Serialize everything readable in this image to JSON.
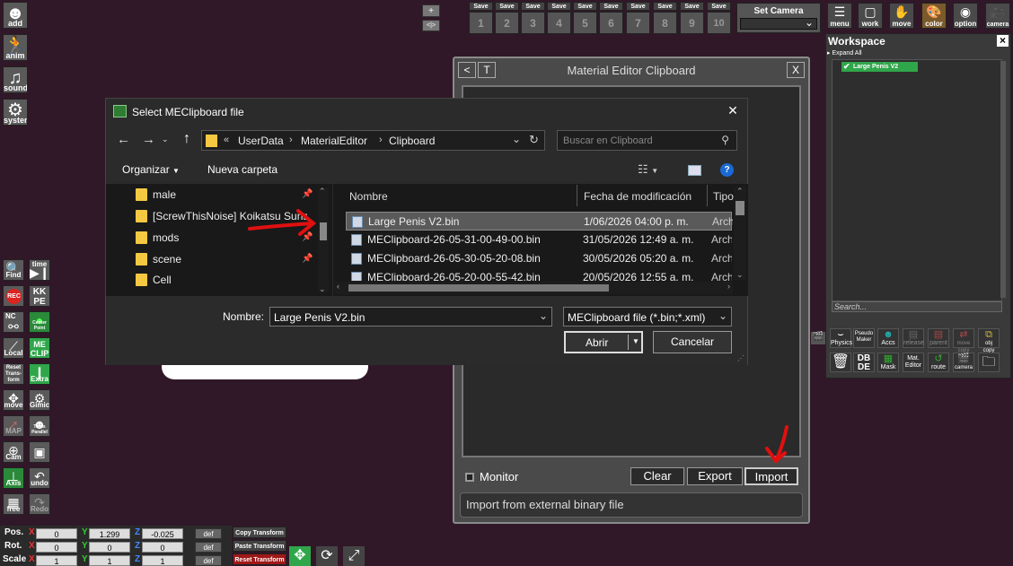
{
  "left_menu": {
    "add": "add",
    "anim": "anim",
    "sound": "sound",
    "system": "system"
  },
  "left_tools": {
    "find": "Find",
    "time": "time",
    "rec": "REC",
    "kkpe": "KK PE",
    "nc": "NC",
    "center_point": "Center Point",
    "local": "Local",
    "me_clip": "ME CLIP",
    "reset_transform": "Reset Trans-form",
    "extra": "Extra",
    "move": "move",
    "gimick": "Gimick",
    "map": "MAP",
    "trans_parallel": "Trans Parallel",
    "cam": "Cam",
    "save": "",
    "axis": "Axis",
    "undo": "undo",
    "free": "free",
    "redo": "Redo"
  },
  "top_center": {
    "plus": "+",
    "arrows": "<|>"
  },
  "save_slots": {
    "label": "Save",
    "numbers": [
      "1",
      "2",
      "3",
      "4",
      "5",
      "6",
      "7",
      "8",
      "9",
      "10"
    ]
  },
  "set_camera": {
    "label": "Set Camera"
  },
  "top_tools": [
    "menu",
    "work",
    "move",
    "color",
    "option",
    "camera"
  ],
  "workspace": {
    "title": "Workspace",
    "close": "×",
    "expand_all": "Expand All",
    "item": "Large Penis V2",
    "search_placeholder": "Search...",
    "buttons_row1": [
      "Physics",
      "Pseudo Maker",
      "Accs",
      "release",
      "parent",
      "move copy",
      "obj copy"
    ],
    "buttons_row2": [
      "",
      "DB DE",
      "Mask",
      "Mat. Editor",
      "route",
      "camera",
      ""
    ]
  },
  "material_editor": {
    "title": "Material Editor Clipboard",
    "back": "<",
    "t": "T",
    "close": "X",
    "monitor": "Monitor",
    "clear": "Clear",
    "export": "Export",
    "import": "Import",
    "status": "Import from external binary file"
  },
  "dialog": {
    "title": "Select MEClipboard file",
    "close": "✕",
    "path": [
      "«",
      "UserData",
      "›",
      "MaterialEditor",
      "›",
      "Clipboard"
    ],
    "search_placeholder": "Buscar en Clipboard",
    "organize": "Organizar",
    "new_folder": "Nueva carpeta",
    "nav": [
      "male",
      "[ScrewThisNoise] Koikatsu Suns",
      "mods",
      "scene",
      "Cell"
    ],
    "columns": {
      "name": "Nombre",
      "date": "Fecha de modificación",
      "type": "Tipo"
    },
    "files": [
      {
        "name": "Large Penis V2.bin",
        "date": "1/06/2026 04:00 p. m.",
        "type": "Arch"
      },
      {
        "name": "MEClipboard-26-05-31-00-49-00.bin",
        "date": "31/05/2026 12:49 a. m.",
        "type": "Arch"
      },
      {
        "name": "MEClipboard-26-05-30-05-20-08.bin",
        "date": "30/05/2026 05:20 a. m.",
        "type": "Arch"
      },
      {
        "name": "MEClipboard-26-05-20-00-55-42.bin",
        "date": "20/05/2026 12:55 a. m.",
        "type": "Arch"
      }
    ],
    "filename_label": "Nombre:",
    "filename_value": "Large Penis V2.bin",
    "filter_value": "MEClipboard file (*.bin;*.xml)",
    "open": "Abrir",
    "cancel": "Cancelar"
  },
  "coords": {
    "pos": {
      "label": "Pos.",
      "x": "0",
      "y": "1.299",
      "z": "-0.025"
    },
    "rot": {
      "label": "Rot.",
      "x": "0",
      "y": "0",
      "z": "0"
    },
    "scale": {
      "label": "Scale",
      "x": "1",
      "y": "1",
      "z": "1"
    },
    "axis_x": "X",
    "axis_y": "Y",
    "axis_z": "Z",
    "def": "def",
    "copy": "Copy Transform",
    "paste": "Paste Transform",
    "reset": "Reset Transform"
  },
  "colors": {
    "bg": "#301828",
    "accent_green": "#2fa64a",
    "arrow_red": "#e01010"
  }
}
